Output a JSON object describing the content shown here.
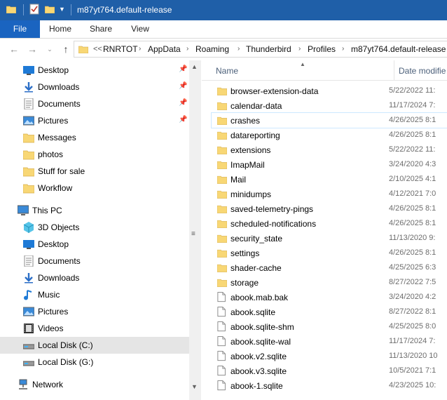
{
  "window": {
    "title": "m87yt764.default-release"
  },
  "ribbon": {
    "tabs": [
      "File",
      "Home",
      "Share",
      "View"
    ]
  },
  "address": {
    "overflow": "<<",
    "crumbs": [
      "RNRTOT",
      "AppData",
      "Roaming",
      "Thunderbird",
      "Profiles",
      "m87yt764.default-release"
    ]
  },
  "nav": {
    "quick": [
      {
        "label": "Desktop",
        "icon": "desktop-icon",
        "pinned": true
      },
      {
        "label": "Downloads",
        "icon": "download-icon",
        "pinned": true
      },
      {
        "label": "Documents",
        "icon": "documents-icon",
        "pinned": true
      },
      {
        "label": "Pictures",
        "icon": "pictures-icon",
        "pinned": true
      },
      {
        "label": "Messages",
        "icon": "folder-icon",
        "pinned": false
      },
      {
        "label": "photos",
        "icon": "folder-icon",
        "pinned": false
      },
      {
        "label": "Stuff for sale",
        "icon": "folder-icon",
        "pinned": false
      },
      {
        "label": "Workflow",
        "icon": "folder-icon",
        "pinned": false
      }
    ],
    "thispc": "This PC",
    "pc_items": [
      {
        "label": "3D Objects",
        "icon": "3d-objects-icon"
      },
      {
        "label": "Desktop",
        "icon": "desktop-icon"
      },
      {
        "label": "Documents",
        "icon": "documents-icon"
      },
      {
        "label": "Downloads",
        "icon": "download-icon"
      },
      {
        "label": "Music",
        "icon": "music-icon"
      },
      {
        "label": "Pictures",
        "icon": "pictures-icon"
      },
      {
        "label": "Videos",
        "icon": "videos-icon"
      },
      {
        "label": "Local Disk (C:)",
        "icon": "disk-icon"
      },
      {
        "label": "Local Disk (G:)",
        "icon": "disk-icon"
      }
    ],
    "network": "Network"
  },
  "columns": {
    "name": "Name",
    "date": "Date modifie"
  },
  "files": [
    {
      "name": "browser-extension-data",
      "date": "5/22/2022 11:",
      "type": "folder"
    },
    {
      "name": "calendar-data",
      "date": "11/17/2024 7:",
      "type": "folder"
    },
    {
      "name": "crashes",
      "date": "4/26/2025 8:1",
      "type": "folder"
    },
    {
      "name": "datareporting",
      "date": "4/26/2025 8:1",
      "type": "folder"
    },
    {
      "name": "extensions",
      "date": "5/22/2022 11:",
      "type": "folder"
    },
    {
      "name": "ImapMail",
      "date": "3/24/2020 4:3",
      "type": "folder"
    },
    {
      "name": "Mail",
      "date": "2/10/2025 4:1",
      "type": "folder"
    },
    {
      "name": "minidumps",
      "date": "4/12/2021 7:0",
      "type": "folder"
    },
    {
      "name": "saved-telemetry-pings",
      "date": "4/26/2025 8:1",
      "type": "folder"
    },
    {
      "name": "scheduled-notifications",
      "date": "4/26/2025 8:1",
      "type": "folder"
    },
    {
      "name": "security_state",
      "date": "11/13/2020 9:",
      "type": "folder"
    },
    {
      "name": "settings",
      "date": "4/26/2025 8:1",
      "type": "folder"
    },
    {
      "name": "shader-cache",
      "date": "4/25/2025 6:3",
      "type": "folder"
    },
    {
      "name": "storage",
      "date": "8/27/2022 7:5",
      "type": "folder"
    },
    {
      "name": "abook.mab.bak",
      "date": "3/24/2020 4:2",
      "type": "file"
    },
    {
      "name": "abook.sqlite",
      "date": "8/27/2022 8:1",
      "type": "file"
    },
    {
      "name": "abook.sqlite-shm",
      "date": "4/25/2025 8:0",
      "type": "file"
    },
    {
      "name": "abook.sqlite-wal",
      "date": "11/17/2024 7:",
      "type": "file"
    },
    {
      "name": "abook.v2.sqlite",
      "date": "11/13/2020 10",
      "type": "file"
    },
    {
      "name": "abook.v3.sqlite",
      "date": "10/5/2021 7:1",
      "type": "file"
    },
    {
      "name": "abook-1.sqlite",
      "date": "4/23/2025 10:",
      "type": "file"
    }
  ],
  "colors": {
    "titlebar": "#1f5fa8",
    "file_tab": "#1a64c0",
    "folder": "#f8d775",
    "selected": "#e5e5e5"
  }
}
